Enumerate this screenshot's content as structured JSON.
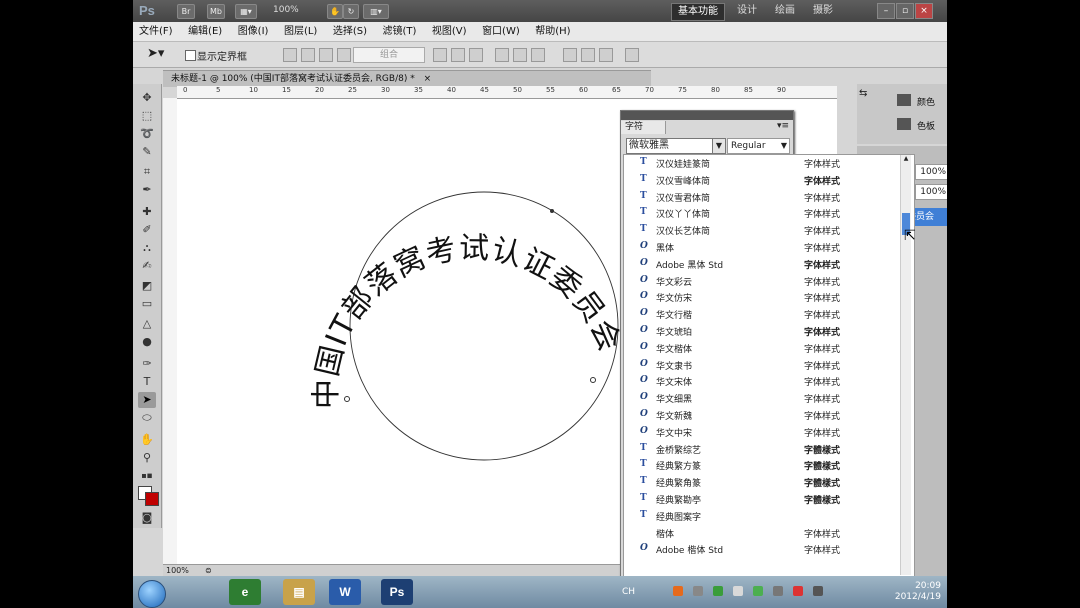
{
  "appbar": {
    "logo": "Ps",
    "mini_buttons": [
      "Br",
      "Mb"
    ],
    "zoom": "100%",
    "workspaces": [
      "基本功能",
      "设计",
      "绘画",
      "摄影"
    ]
  },
  "menu": [
    "文件(F)",
    "编辑(E)",
    "图像(I)",
    "图层(L)",
    "选择(S)",
    "滤镜(T)",
    "视图(V)",
    "窗口(W)",
    "帮助(H)"
  ],
  "options": {
    "show_bounds_label": "显示定界框",
    "combine_label": "组合"
  },
  "document": {
    "tab_title": "未标题-1 @ 100% (中国IT部落窝考试认证委员会, RGB/8) *",
    "close_x": "×",
    "ruler_ticks": [
      "0",
      "5",
      "10",
      "15",
      "20",
      "25",
      "30",
      "35",
      "40",
      "45",
      "50",
      "55",
      "60",
      "65",
      "70",
      "75",
      "80",
      "85",
      "90"
    ],
    "zoom_status": "100%",
    "curved_text": "中国IT部落窝考试认证委员会"
  },
  "right_panel": {
    "color_label": "颜色",
    "swatches_label": "色板",
    "opacity1": "100%",
    "opacity2": "100%",
    "layer_highlight": "委员会"
  },
  "char_panel": {
    "tab": "字符",
    "font_family": "微软雅黑",
    "font_style": "Regular",
    "fonts": [
      {
        "name": "汉仪娃娃篆简",
        "type": "T",
        "sample": "字体样式"
      },
      {
        "name": "汉仪雪峰体简",
        "type": "T",
        "sample": "字体样式",
        "bold": true
      },
      {
        "name": "汉仪雪君体简",
        "type": "T",
        "sample": "字体样式"
      },
      {
        "name": "汉仪丫丫体简",
        "type": "T",
        "sample": "字体样式"
      },
      {
        "name": "汉仪长艺体简",
        "type": "T",
        "sample": "字体样式"
      },
      {
        "name": "黑体",
        "type": "O",
        "sample": "字体样式"
      },
      {
        "name": "Adobe 黑体 Std",
        "type": "O",
        "sample": "字体样式",
        "bold": true
      },
      {
        "name": "华文彩云",
        "type": "O",
        "sample": "字体样式"
      },
      {
        "name": "华文仿宋",
        "type": "O",
        "sample": "字体样式"
      },
      {
        "name": "华文行楷",
        "type": "O",
        "sample": "字体样式"
      },
      {
        "name": "华文琥珀",
        "type": "O",
        "sample": "字体样式",
        "bold": true
      },
      {
        "name": "华文楷体",
        "type": "O",
        "sample": "字体样式"
      },
      {
        "name": "华文隶书",
        "type": "O",
        "sample": "字体样式"
      },
      {
        "name": "华文宋体",
        "type": "O",
        "sample": "字体样式"
      },
      {
        "name": "华文细黑",
        "type": "O",
        "sample": "字体样式"
      },
      {
        "name": "华文新魏",
        "type": "O",
        "sample": "字体样式"
      },
      {
        "name": "华文中宋",
        "type": "O",
        "sample": "字体样式"
      },
      {
        "name": "金桥繁综艺",
        "type": "T",
        "sample": "字體樣式",
        "bold": true
      },
      {
        "name": "经典繁方篆",
        "type": "T",
        "sample": "字體樣式",
        "bold": true
      },
      {
        "name": "经典繁角篆",
        "type": "T",
        "sample": "字體樣式",
        "bold": true
      },
      {
        "name": "经典繁勘亭",
        "type": "T",
        "sample": "字體樣式",
        "bold": true
      },
      {
        "name": "经典图案字",
        "type": "T",
        "sample": ""
      },
      {
        "name": "楷体",
        "type": "",
        "sample": "字体样式"
      },
      {
        "name": "Adobe 楷体 Std",
        "type": "O",
        "sample": "字体样式"
      }
    ]
  },
  "taskbar": {
    "lang": "CH",
    "time": "20:09",
    "date": "2012/4/19",
    "apps": [
      "e",
      "W",
      "Ps"
    ]
  }
}
